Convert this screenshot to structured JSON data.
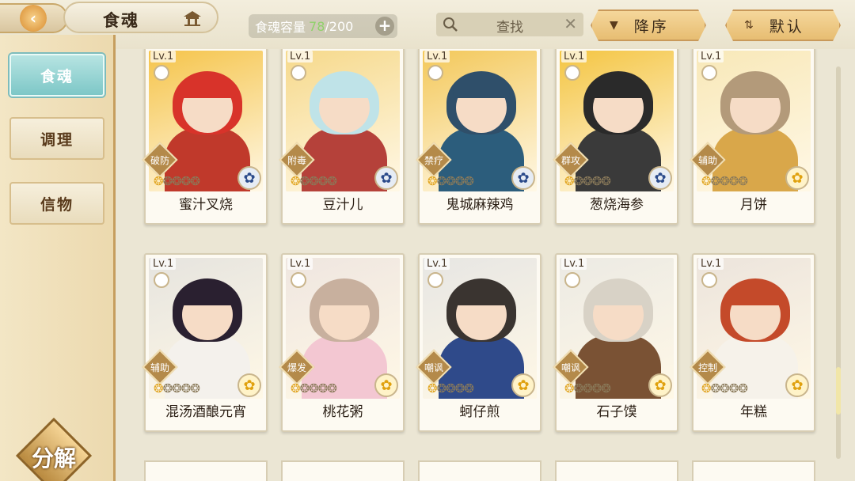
{
  "header": {
    "title": "食魂",
    "capacity_label": "食魂容量",
    "capacity_current": "78",
    "capacity_max": "/200",
    "search_label": "查找",
    "sort_order_label": "降序",
    "sort_mode_label": "默认"
  },
  "sidebar": {
    "tabs": [
      {
        "label": "食魂",
        "active": true
      },
      {
        "label": "调理",
        "active": false
      },
      {
        "label": "信物",
        "active": false
      }
    ],
    "decompose_label": "分解"
  },
  "cards": [
    {
      "level": "Lv.1",
      "name": "蜜汁叉烧",
      "role": "破防",
      "emblem": "blue-flower",
      "bg": "#f5c44a",
      "hair": "#d8332a",
      "outfit": "#c0392b"
    },
    {
      "level": "Lv.1",
      "name": "豆汁儿",
      "role": "附毒",
      "emblem": "blue-flower",
      "bg": "#f6d98b",
      "hair": "#bfe3e8",
      "outfit": "#b5413a"
    },
    {
      "level": "Lv.1",
      "name": "鬼城麻辣鸡",
      "role": "禁疗",
      "emblem": "blue-flower",
      "bg": "#f3c85a",
      "hair": "#2f4f6a",
      "outfit": "#2c5d7c"
    },
    {
      "level": "Lv.1",
      "name": "葱烧海参",
      "role": "群攻",
      "emblem": "blue-flower",
      "bg": "#f4c542",
      "hair": "#2a2a2a",
      "outfit": "#3a3a3a"
    },
    {
      "level": "Lv.1",
      "name": "月饼",
      "role": "辅助",
      "emblem": "gold-flower",
      "bg": "#f8e8b8",
      "hair": "#b39a7a",
      "outfit": "#d9a74a"
    },
    {
      "level": "Lv.1",
      "name": "混汤酒酿元宵",
      "role": "辅助",
      "emblem": "gold-flower",
      "bg": "#e6e4df",
      "hair": "#2a2030",
      "outfit": "#f4f1ec"
    },
    {
      "level": "Lv.1",
      "name": "桃花粥",
      "role": "爆发",
      "emblem": "gold-flower",
      "bg": "#efe6e0",
      "hair": "#c8b09e",
      "outfit": "#f3c7d2"
    },
    {
      "level": "Lv.1",
      "name": "蚵仔煎",
      "role": "嘲讽",
      "emblem": "gold-flower",
      "bg": "#e7e6e3",
      "hair": "#3a3430",
      "outfit": "#2f4a8a"
    },
    {
      "level": "Lv.1",
      "name": "石子馍",
      "role": "嘲讽",
      "emblem": "gold-flower",
      "bg": "#eceae4",
      "hair": "#d8d2c6",
      "outfit": "#7a5234"
    },
    {
      "level": "Lv.1",
      "name": "年糕",
      "role": "控制",
      "emblem": "gold-flower",
      "bg": "#ece4dc",
      "hair": "#c44a2a",
      "outfit": "#f6f2ea"
    }
  ],
  "stars": {
    "lit": 1,
    "total": 5
  }
}
